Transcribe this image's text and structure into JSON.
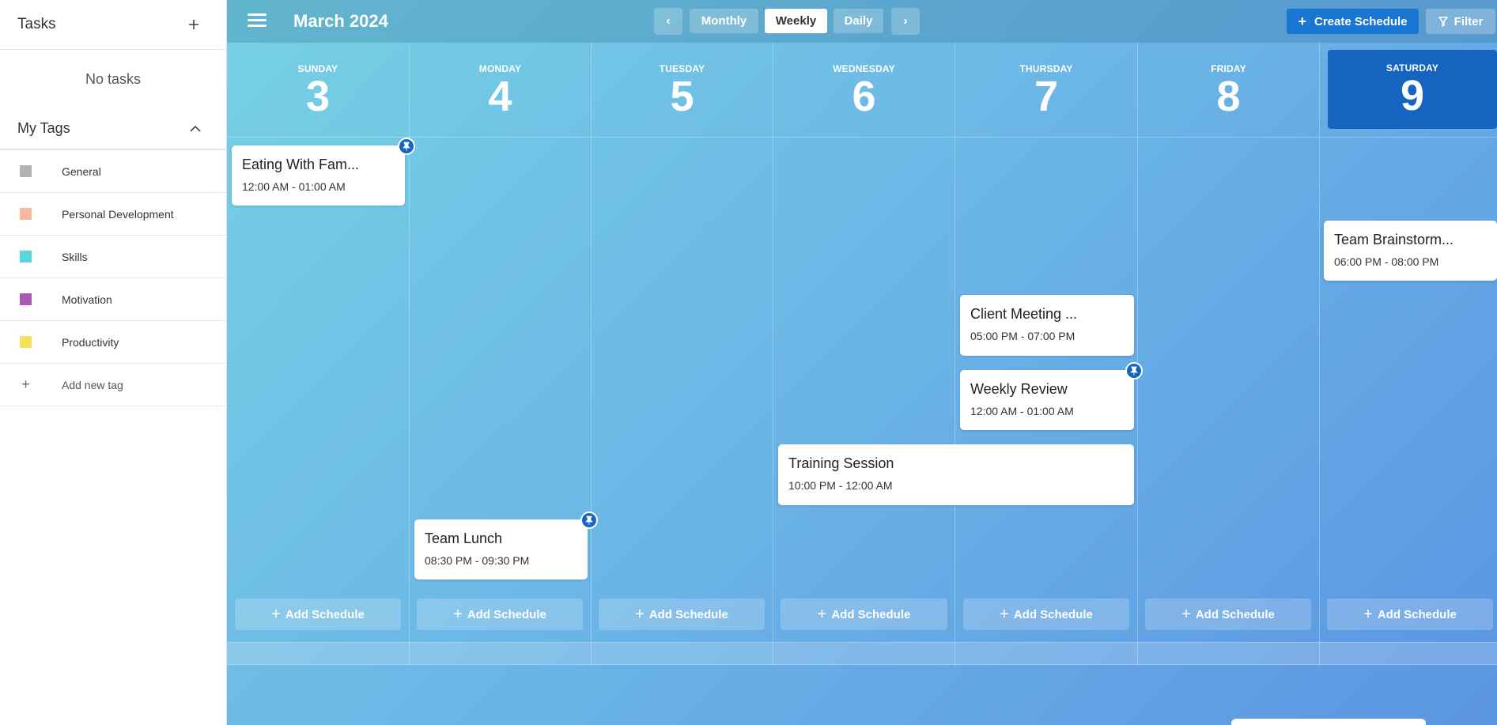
{
  "sidebar": {
    "tasks_title": "Tasks",
    "no_tasks": "No tasks",
    "tags_title": "My Tags",
    "tags": [
      {
        "label": "General",
        "color": "#b3b3b3"
      },
      {
        "label": "Personal Development",
        "color": "#f7b89c"
      },
      {
        "label": "Skills",
        "color": "#5ad7dc"
      },
      {
        "label": "Motivation",
        "color": "#a85cb0"
      },
      {
        "label": "Productivity",
        "color": "#f6e25a"
      }
    ],
    "add_tag_label": "Add new tag"
  },
  "header": {
    "title": "March 2024",
    "views": [
      "Monthly",
      "Weekly",
      "Daily"
    ],
    "active_view": "Weekly",
    "create_label": "Create Schedule",
    "filter_label": "Filter"
  },
  "days": [
    {
      "name": "SUNDAY",
      "num": "3"
    },
    {
      "name": "MONDAY",
      "num": "4"
    },
    {
      "name": "TUESDAY",
      "num": "5"
    },
    {
      "name": "WEDNESDAY",
      "num": "6"
    },
    {
      "name": "THURSDAY",
      "num": "7"
    },
    {
      "name": "FRIDAY",
      "num": "8"
    },
    {
      "name": "SATURDAY",
      "num": "9",
      "today": true
    }
  ],
  "add_schedule_label": "Add Schedule",
  "events": [
    {
      "title": "Eating With Fam...",
      "time": "12:00 AM - 01:00 AM",
      "pinned": true
    },
    {
      "title": "Team Lunch",
      "time": "08:30 PM - 09:30 PM",
      "pinned": true
    },
    {
      "title": "Training Session",
      "time": "10:00 PM - 12:00 AM",
      "pinned": false
    },
    {
      "title": "Client Meeting ...",
      "time": "05:00 PM - 07:00 PM",
      "pinned": false
    },
    {
      "title": "Weekly Review",
      "time": "12:00 AM - 01:00 AM",
      "pinned": true
    },
    {
      "title": "Team Brainstorm...",
      "time": "06:00 PM - 08:00 PM",
      "pinned": false
    }
  ],
  "colors": {
    "accent": "#1976d2",
    "today": "#1565c0"
  }
}
